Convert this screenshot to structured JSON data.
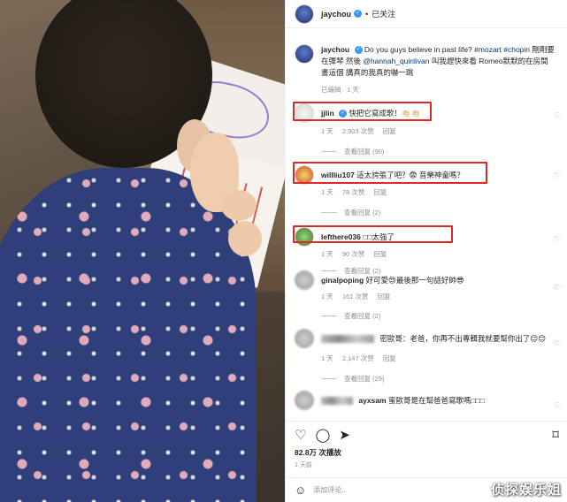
{
  "header": {
    "username": "jaychou",
    "follow_status": "已关注"
  },
  "caption": {
    "username": "jaychou",
    "text_a": "Do you guys believe in past life? ",
    "tag1": "#mozart",
    "tag2": "#chopin",
    "text_b": " 剛剛要在彈琴 然後 ",
    "mention": "@hannah_quinlivan",
    "text_c": " 叫我趕快來看 Romeo默默的在房間畫這個 講真的我真的嚇一跳",
    "edited": "已编辑",
    "time": "1 天"
  },
  "comments": [
    {
      "username": "jjlin",
      "text": "快把它寫成歌！👏🏻👏🏻",
      "time": "1 天",
      "likes": "2,903 次赞",
      "reply": "回复",
      "view_replies": "查看回复 (90)"
    },
    {
      "username": "willliu107",
      "text": "這太誇張了吧？😨 音樂神童嗎？",
      "time": "1 天",
      "likes": "78 次赞",
      "reply": "回复",
      "view_replies": "查看回复 (2)"
    },
    {
      "username": "lefthere036",
      "text": "□□太強了",
      "time": "1 天",
      "likes": "90 次赞",
      "reply": "回复",
      "view_replies": "查看回复 (2)"
    },
    {
      "username": "ginalpoping",
      "text": "好可愛😍最後那一句話好帥😎",
      "time": "1 天",
      "likes": "161 次赞",
      "reply": "回复",
      "view_replies": "查看回复 (2)"
    },
    {
      "username": "",
      "text": "密歐哥：老爸，你再不出專輯我就要幫你出了😊😊",
      "time": "1 天",
      "likes": "2,147 次赞",
      "reply": "回复",
      "view_replies": "查看回复 (29)"
    },
    {
      "username": "ayxsam",
      "text": "蜜歐哥是在幫爸爸寫歌嗎□□□"
    }
  ],
  "footer": {
    "likes": "82.8万 次播放",
    "date": "1 天前",
    "add_comment_placeholder": "添加评论..."
  },
  "watermark": "侦探娱乐姐"
}
